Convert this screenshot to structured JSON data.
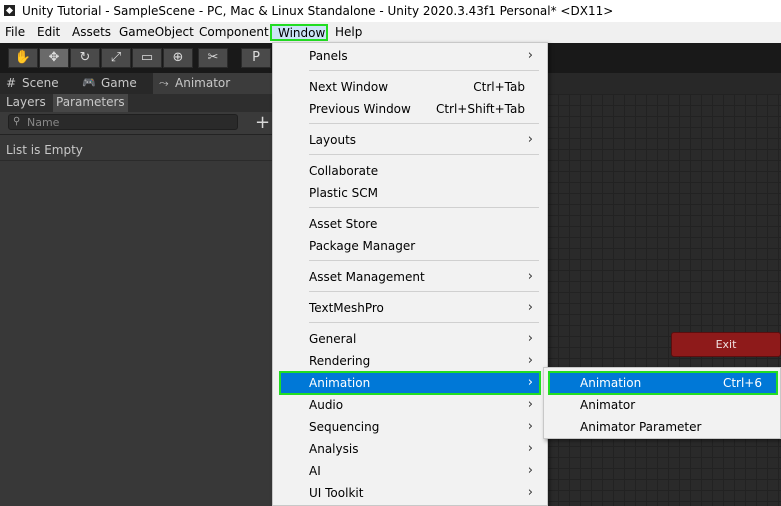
{
  "window": {
    "title": "Unity Tutorial - SampleScene - PC, Mac & Linux Standalone - Unity 2020.3.43f1 Personal* <DX11>"
  },
  "menubar": {
    "items": [
      "File",
      "Edit",
      "Assets",
      "GameObject",
      "Component",
      "Window",
      "Help"
    ]
  },
  "toolbar": {
    "tools": [
      "hand-icon",
      "move-icon",
      "rotate-icon",
      "scale-icon",
      "rect-icon",
      "transform-icon",
      "custom-tool-icon"
    ],
    "pivot_label": "P"
  },
  "tabs": [
    {
      "label": "Scene",
      "icon": "grid-icon"
    },
    {
      "label": "Game",
      "icon": "gamepad-icon"
    },
    {
      "label": "Animator",
      "icon": "animator-icon"
    }
  ],
  "leftpanel": {
    "subtabs": [
      "Layers",
      "Parameters"
    ],
    "search_placeholder": "Name",
    "add_label": "+",
    "empty_text": "List is Empty"
  },
  "graph": {
    "exit_node": "Exit"
  },
  "window_menu": {
    "items": [
      {
        "label": "Panels",
        "shortcut": "",
        "submenu": true
      },
      {
        "label": "Next Window",
        "shortcut": "Ctrl+Tab",
        "submenu": false
      },
      {
        "label": "Previous Window",
        "shortcut": "Ctrl+Shift+Tab",
        "submenu": false
      },
      {
        "label": "Layouts",
        "shortcut": "",
        "submenu": true
      },
      {
        "label": "Collaborate",
        "shortcut": "",
        "submenu": false
      },
      {
        "label": "Plastic SCM",
        "shortcut": "",
        "submenu": false
      },
      {
        "label": "Asset Store",
        "shortcut": "",
        "submenu": false
      },
      {
        "label": "Package Manager",
        "shortcut": "",
        "submenu": false
      },
      {
        "label": "Asset Management",
        "shortcut": "",
        "submenu": true
      },
      {
        "label": "TextMeshPro",
        "shortcut": "",
        "submenu": true
      },
      {
        "label": "General",
        "shortcut": "",
        "submenu": true
      },
      {
        "label": "Rendering",
        "shortcut": "",
        "submenu": true
      },
      {
        "label": "Animation",
        "shortcut": "",
        "submenu": true,
        "highlighted": true
      },
      {
        "label": "Audio",
        "shortcut": "",
        "submenu": true
      },
      {
        "label": "Sequencing",
        "shortcut": "",
        "submenu": true
      },
      {
        "label": "Analysis",
        "shortcut": "",
        "submenu": true
      },
      {
        "label": "AI",
        "shortcut": "",
        "submenu": true
      },
      {
        "label": "UI Toolkit",
        "shortcut": "",
        "submenu": true
      }
    ],
    "arrow": "›"
  },
  "animation_submenu": {
    "items": [
      {
        "label": "Animation",
        "shortcut": "Ctrl+6",
        "highlighted": true
      },
      {
        "label": "Animator",
        "shortcut": ""
      },
      {
        "label": "Animator Parameter",
        "shortcut": ""
      }
    ]
  },
  "colors": {
    "highlight": "#0078d7",
    "annotation_outline": "#22dd22",
    "exit_node": "#8e1a1a"
  }
}
